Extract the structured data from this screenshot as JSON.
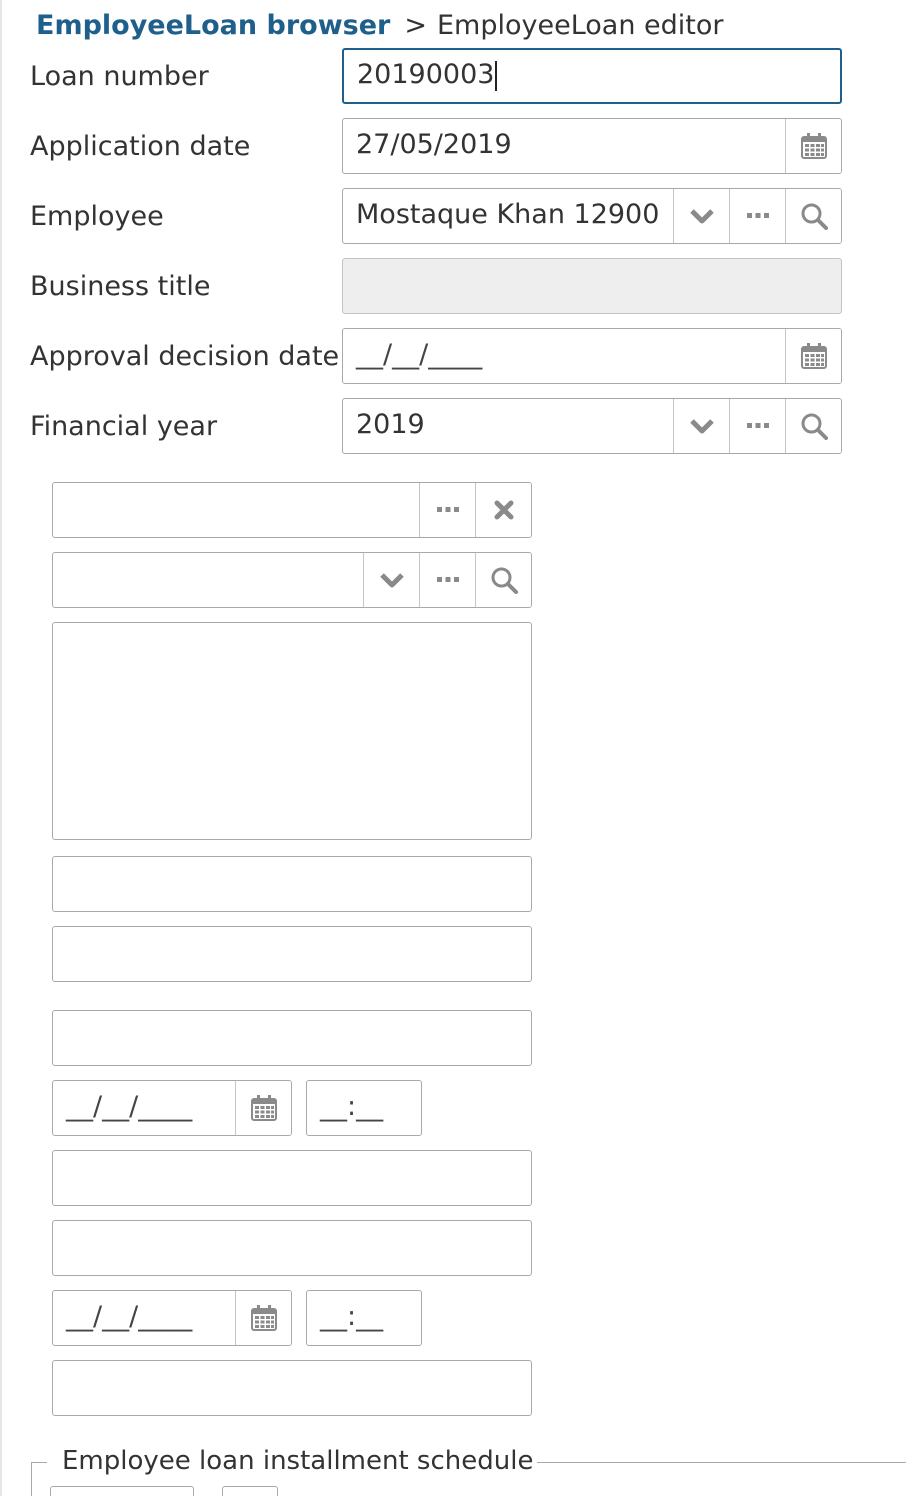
{
  "breadcrumb": {
    "browser_link": "EmployeeLoan browser",
    "separator": ">",
    "current": "EmployeeLoan editor"
  },
  "form": {
    "loan_number": {
      "label": "Loan number",
      "value": "20190003"
    },
    "application_date": {
      "label": "Application date",
      "value": "27/05/2019"
    },
    "employee": {
      "label": "Employee",
      "value": "Mostaque Khan 12900"
    },
    "business_title": {
      "label": "Business title",
      "value": ""
    },
    "approval_decision_date": {
      "label": "Approval decision date",
      "value": "__/__/____"
    },
    "financial_year": {
      "label": "Financial year",
      "value": "2019"
    }
  },
  "unlabeled": {
    "date_mask_1": "__/__/____",
    "time_mask_1": "__:__",
    "date_mask_2": "__/__/____",
    "time_mask_2": "__:__"
  },
  "section": {
    "installment_schedule_legend": "Employee loan installment schedule"
  },
  "icons": {
    "calendar": "calendar-icon",
    "dropdown": "chevron-down-icon",
    "more": "ellipsis-icon",
    "search": "search-icon",
    "clear": "close-icon"
  },
  "colors": {
    "link": "#1f5f8b",
    "focus_border": "#1f5f8b",
    "border": "#a9a9a9",
    "readonly_bg": "#eeeeee",
    "icon": "#8a8a8a"
  }
}
